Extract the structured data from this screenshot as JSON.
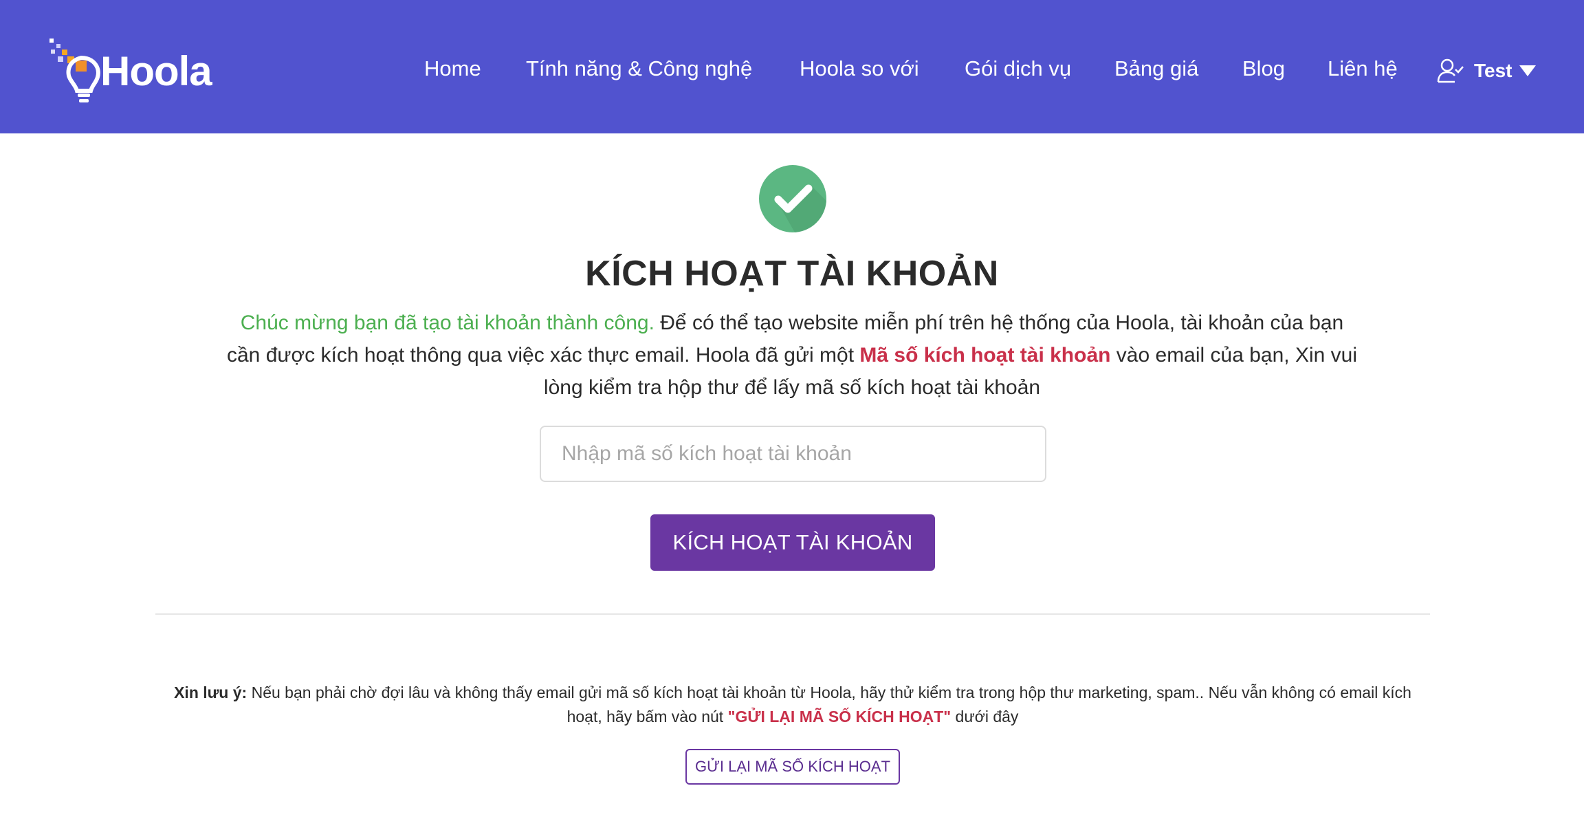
{
  "brand": {
    "name": "Hoola"
  },
  "nav": {
    "items": [
      {
        "label": "Home"
      },
      {
        "label": "Tính năng & Công nghệ"
      },
      {
        "label": "Hoola so với"
      },
      {
        "label": "Gói dịch vụ"
      },
      {
        "label": "Bảng giá"
      },
      {
        "label": "Blog"
      },
      {
        "label": "Liên hệ"
      }
    ],
    "user": {
      "name": "Test",
      "icon": "user-check-icon",
      "dropdown_icon": "caret-down-icon"
    }
  },
  "main": {
    "status_icon": "check-circle-icon",
    "title": "KÍCH HOẠT TÀI KHOẢN",
    "intro": {
      "success": "Chúc mừng bạn đã tạo tài khoản thành công.",
      "part1": " Để có thể tạo website miễn phí trên hệ thống của Hoola, tài khoản của bạn cần được kích hoạt thông qua việc xác thực email. Hoola đã gửi một ",
      "highlight": "Mã số kích hoạt tài khoản",
      "part2": " vào email của bạn, Xin vui lòng kiểm tra hộp thư để lấy mã số kích hoạt tài khoản"
    },
    "code_input": {
      "placeholder": "Nhập mã số kích hoạt tài khoản",
      "value": ""
    },
    "activate_button": "KÍCH HOẠT TÀI KHOẢN",
    "note": {
      "label": "Xin lưu ý:",
      "text1": " Nếu bạn phải chờ đợi lâu và không thấy email gửi mã số kích hoạt tài khoản từ Hoola, hãy thử kiểm tra trong hộp thư marketing, spam.. Nếu vẫn không có email kích hoạt, hãy bấm vào nút ",
      "highlight": "\"GỬI LẠI MÃ SỐ KÍCH HOẠT\"",
      "text2": " dưới đây"
    },
    "resend_button": "GỬI LẠI MÃ SỐ KÍCH HOẠT"
  },
  "colors": {
    "header_bg": "#5153cf",
    "primary_button": "#6a37a2",
    "success_green": "#4caf50",
    "highlight_red": "#c9304a",
    "check_green": "#5bb782"
  }
}
